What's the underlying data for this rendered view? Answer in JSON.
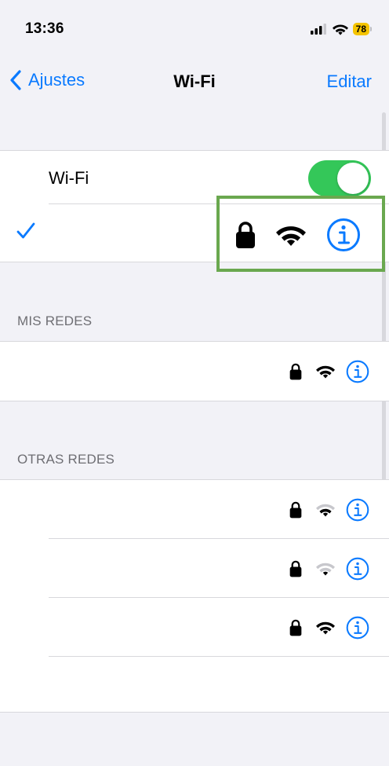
{
  "status_bar": {
    "time": "13:36",
    "battery_level": "78"
  },
  "nav": {
    "back_label": "Ajustes",
    "title": "Wi-Fi",
    "edit_label": "Editar"
  },
  "wifi_toggle": {
    "label": "Wi-Fi",
    "on": true
  },
  "connected_network": {
    "name": "",
    "secured": true,
    "signal": "full"
  },
  "sections": {
    "my_networks": {
      "header": "MIS REDES"
    },
    "other_networks": {
      "header": "OTRAS REDES"
    }
  },
  "colors": {
    "accent": "#0a7aff",
    "toggle_on": "#34c759",
    "highlight": "#6aa84f",
    "battery": "#f5c400"
  },
  "icons": [
    "chevron-left-icon",
    "lock-icon",
    "wifi-icon",
    "info-icon",
    "checkmark-icon",
    "signal-bars-icon",
    "battery-icon"
  ]
}
